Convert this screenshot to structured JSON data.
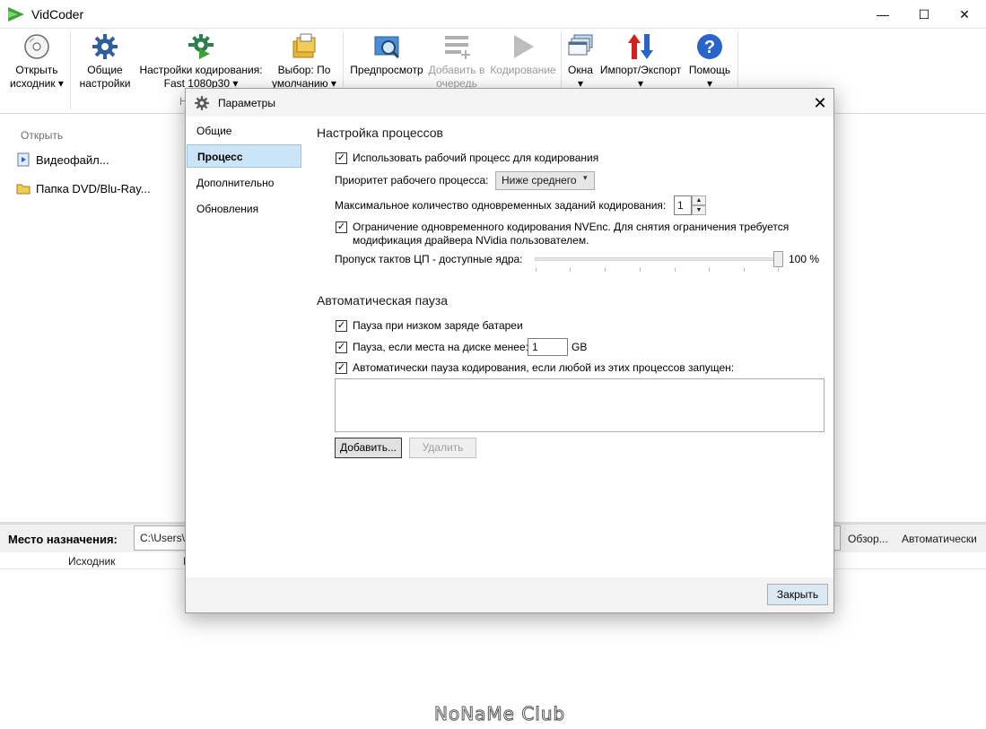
{
  "window": {
    "title": "VidCoder",
    "minimize": "—",
    "maximize": "☐",
    "close": "✕"
  },
  "ribbon": {
    "open_source": [
      "Открыть",
      "исходник ▾"
    ],
    "general_settings": [
      "Общие",
      "настройки"
    ],
    "encode_settings": [
      "Настройки кодирования:",
      "Fast 1080p30 ▾"
    ],
    "picker": [
      "Выбор: По",
      "умолчанию ▾"
    ],
    "preview": "Предпросмотр",
    "add_to_queue": [
      "Добавить в",
      "очередь"
    ],
    "encode": "Кодирование",
    "windows": [
      "Окна",
      "▾"
    ],
    "import_export": [
      "Импорт/Экспорт",
      "▾"
    ],
    "help": [
      "Помощь",
      "▾"
    ],
    "group_label_fragment": "Н"
  },
  "main": {
    "open_header": "Открыть",
    "open_items": [
      "Видеофайл...",
      "Папка DVD/Blu-Ray..."
    ],
    "destination_label": "Место назначения:",
    "destination_value": "C:\\Users\\",
    "browse": "Обзор...",
    "auto": "Автоматически",
    "col_source": "Исходник",
    "col_fragment": "I"
  },
  "watermark": "NoNaMe Club",
  "dialog": {
    "title": "Параметры",
    "close_glyph": "✕",
    "nav": [
      "Общие",
      "Процесс",
      "Дополнительно",
      "Обновления"
    ],
    "active_nav_index": 1,
    "section1": "Настройка процессов",
    "use_worker": {
      "label": "Использовать рабочий процесс для кодирования",
      "checked": true
    },
    "priority_label": "Приоритет рабочего процесса:",
    "priority_value": "Ниже среднего",
    "max_jobs_label": "Максимальное количество одновременных заданий кодирования:",
    "max_jobs_value": "1",
    "nvenc": {
      "line1": "Ограничение одновременного кодирования NVEnc. Для снятия ограничения требуется",
      "line2": "модификация драйвера NVidia пользователем.",
      "checked": true
    },
    "cpu_label": "Пропуск тактов ЦП - доступные ядра:",
    "cpu_value": "100 %",
    "cpu_fraction": 1.0,
    "section2": "Автоматическая пауза",
    "pause_battery": {
      "label": "Пауза при низком заряде батареи",
      "checked": true
    },
    "pause_disk": {
      "label": "Пауза, если места на диске менее:",
      "value": "1",
      "unit": "GB",
      "checked": true
    },
    "pause_processes": {
      "label": "Автоматически пауза кодирования, если любой из этих процессов запущен:",
      "checked": true
    },
    "add_button": "Добавить...",
    "remove_button": "Удалить",
    "close_button": "Закрыть"
  },
  "colors": {
    "accent_selection": "#cce4f7",
    "vid_green": "#3aa335",
    "import_red": "#d02020",
    "help_blue": "#2a64c8"
  }
}
